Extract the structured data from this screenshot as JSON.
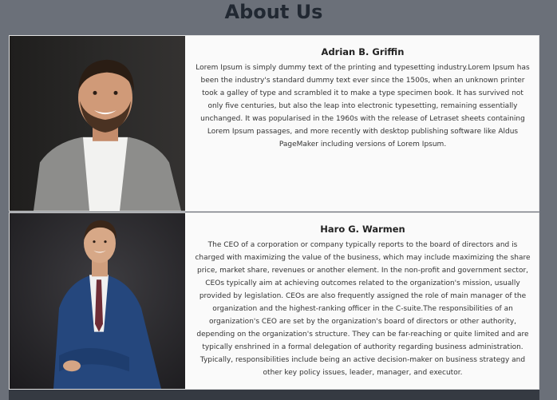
{
  "page_title": "About Us",
  "people": [
    {
      "name": "Adrian B. Griffin",
      "bio": "Lorem Ipsum is simply dummy text of the printing and typesetting industry.Lorem Ipsum has been the industry's standard dummy text ever since the 1500s, when an unknown printer took a galley of type and scrambled it to make a type specimen book. It has survived not only five centuries, but also the leap into electronic typesetting, remaining essentially unchanged. It was popularised in the 1960s with the release of Letraset sheets containing Lorem Ipsum passages, and more recently with desktop publishing software like Aldus PageMaker including versions of Lorem Ipsum."
    },
    {
      "name": "Haro G. Warmen",
      "bio": "The CEO of a corporation or company typically reports to the board of directors and is charged with maximizing the value of the business, which may include maximizing the share price, market share, revenues or another element. In the non-profit and government sector, CEOs typically aim at achieving outcomes related to the organization's mission, usually provided by legislation. CEOs are also frequently assigned the role of main manager of the organization and the highest-ranking officer in the C-suite.The responsibilities of an organization's CEO are set by the organization's board of directors or other authority, depending on the organization's structure. They can be far-reaching or quite limited and are typically enshrined in a formal delegation of authority regarding business administration. Typically, responsibilities include being an active decision-maker on business strategy and other key policy issues, leader, manager, and executor."
    }
  ],
  "colors": {
    "background": "#6b7079",
    "card": "#fafafa",
    "title": "#212832"
  }
}
